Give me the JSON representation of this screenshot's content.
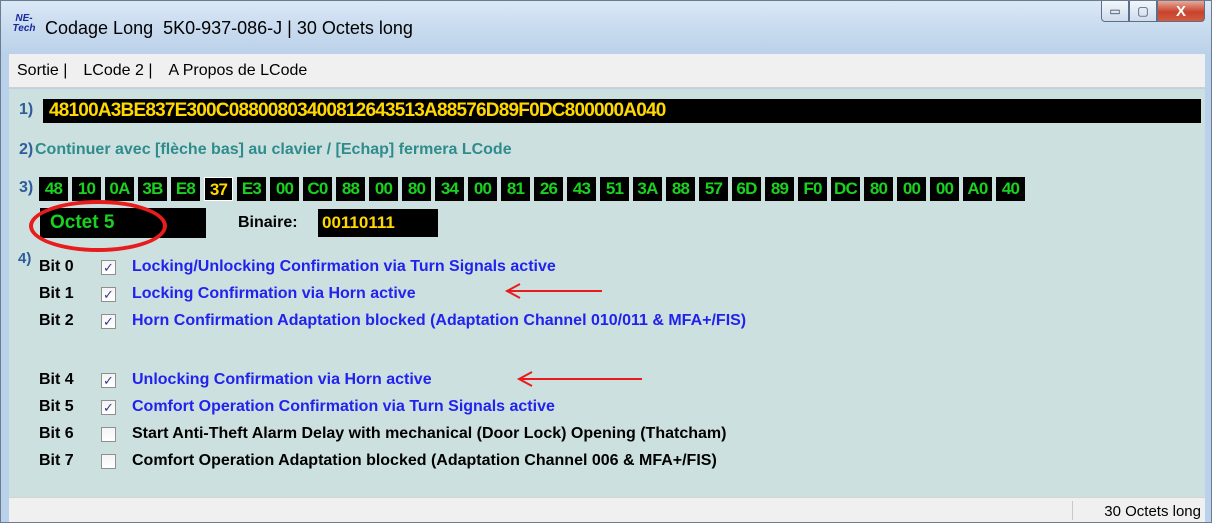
{
  "window": {
    "app_icon_lines": [
      "NE-",
      "Tech"
    ],
    "title": "Codage Long  5K0-937-086-J | 30 Octets long",
    "minimize_glyph": "▭",
    "maximize_glyph": "▢",
    "close_glyph": "X"
  },
  "menu": {
    "items": [
      "Sortie |",
      "LCode 2 |",
      "A Propos de LCode"
    ]
  },
  "step1": {
    "label": "1)",
    "coding": "48100A3BE837E300C0880080340081264351 3A88576D89F0DC800000A040"
  },
  "step2": {
    "label": "2)",
    "hint": "Continuer avec [flèche bas] au clavier / [Echap] fermera LCode"
  },
  "step3": {
    "label": "3)",
    "bytes": [
      "48",
      "10",
      "0A",
      "3B",
      "E8",
      "37",
      "E3",
      "00",
      "C0",
      "88",
      "00",
      "80",
      "34",
      "00",
      "81",
      "26",
      "43",
      "51",
      "3A",
      "88",
      "57",
      "6D",
      "89",
      "F0",
      "DC",
      "80",
      "00",
      "00",
      "A0",
      "40"
    ],
    "selected_index": 5
  },
  "octet": {
    "label": "Octet 5",
    "binaire_label": "Binaire:",
    "binaire_value": "00110111"
  },
  "step4": {
    "label": "4)",
    "bits": [
      {
        "name": "Bit 0",
        "checked": true,
        "text": "Locking/Unlocking Confirmation via Turn Signals active"
      },
      {
        "name": "Bit 1",
        "checked": true,
        "text": "Locking Confirmation via Horn active"
      },
      {
        "name": "Bit 2",
        "checked": true,
        "text": "Horn Confirmation Adaptation blocked (Adaptation Channel 010/011 & MFA+/FIS)"
      },
      {
        "name": "Bit 4",
        "checked": true,
        "text": "Unlocking Confirmation via Horn active"
      },
      {
        "name": "Bit 5",
        "checked": true,
        "text": "Comfort Operation Confirmation via Turn Signals active"
      },
      {
        "name": "Bit 6",
        "checked": false,
        "text": "Start Anti-Theft Alarm Delay with mechanical (Door Lock) Opening (Thatcham)"
      },
      {
        "name": "Bit 7",
        "checked": false,
        "text": "Comfort Operation Adaptation blocked (Adaptation Channel 006 & MFA+/FIS)"
      }
    ],
    "check_glyph": "✓"
  },
  "status": {
    "text": "30 Octets long"
  },
  "colors": {
    "annotation_red": "#e81c1c",
    "active_bit_blue": "#2222ee",
    "byte_green": "#19d21f",
    "hex_yellow": "#ffd800"
  }
}
